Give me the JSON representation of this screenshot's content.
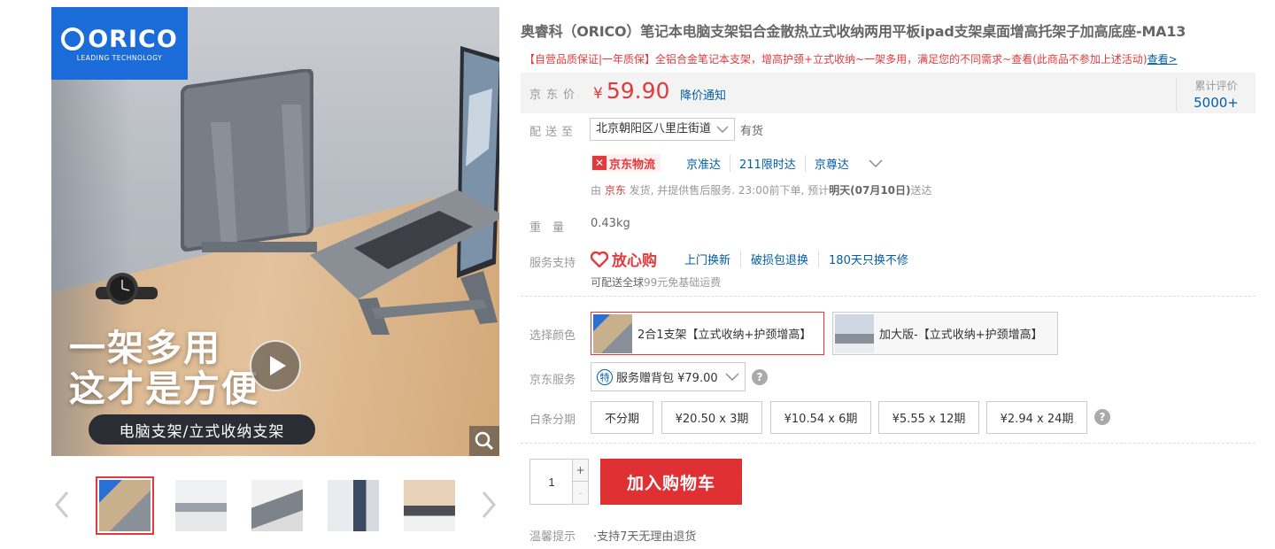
{
  "gallery": {
    "brand_logo": "ORICO",
    "brand_tagline": "LEADING TECHNOLOGY",
    "headline_line1": "一架多用",
    "headline_line2": "这才是方便",
    "subband": "电脑支架/立式收纳支架",
    "thumb_count": 5,
    "active_thumb": 0,
    "icons": [
      "play-icon",
      "zoom-icon",
      "chevron-left-icon",
      "chevron-right-icon"
    ]
  },
  "product": {
    "title": "奥睿科（ORICO）笔记本电脑支架铝合金散热立式收纳两用平板ipad支架桌面增高托架子加高底座-MA13",
    "promo": "【自营品质保证|一年质保】全铝合金笔记本支架，增高护颈+立式收纳~一架多用，满足您的不同需求~查看(此商品不参加上述活动)",
    "promo_link": "查看>"
  },
  "price": {
    "label": "京东价",
    "currency": "¥",
    "value": "59.90",
    "notify": "降价通知",
    "review_label": "累计评价",
    "review_count": "5000+"
  },
  "delivery": {
    "label": "配送至",
    "address": "北京朝阳区八里庄街道",
    "stock": "有货",
    "logistics_brand": "京东物流",
    "logistics_links": [
      "京准达",
      "211限时达",
      "京尊达"
    ],
    "seller_prefix": "由 ",
    "seller": "京东",
    "ship_mid": " 发货, 并提供售后服务. 23:00前下单, 预计",
    "ship_eta": "明天(07月10日)",
    "ship_suffix": "送达"
  },
  "weight": {
    "label": "重　量",
    "value": "0.43kg"
  },
  "service": {
    "label": "服务支持",
    "badge": "放心购",
    "links": [
      "上门换新",
      "破损包退换",
      "180天只换不修"
    ],
    "free_ship_prefix": "可配送全球",
    "free_ship_text": "99元免基础运费"
  },
  "color": {
    "label": "选择颜色",
    "options": [
      {
        "label": "2合1支架【立式收纳+护颈增高】",
        "selected": true
      },
      {
        "label": "加大版-【立式收纳+护颈增高】",
        "selected": false
      }
    ]
  },
  "jd_service": {
    "label": "京东服务",
    "badge": "特",
    "value": "服务赠背包 ¥79.00"
  },
  "installment": {
    "label": "白条分期",
    "options": [
      "不分期",
      "¥20.50 x 3期",
      "¥10.54 x 6期",
      "¥5.55 x 12期",
      "¥2.94 x 24期"
    ]
  },
  "cart": {
    "quantity": "1",
    "plus": "+",
    "minus": "-",
    "button": "加入购物车"
  },
  "tips": {
    "label": "温馨提示",
    "text": "·支持7天无理由退货"
  },
  "colors": {
    "accent_red": "#e4393c",
    "link_blue": "#005ea7",
    "brand_blue": "#1b6cd8",
    "price_bg": "#f3f3f3"
  }
}
